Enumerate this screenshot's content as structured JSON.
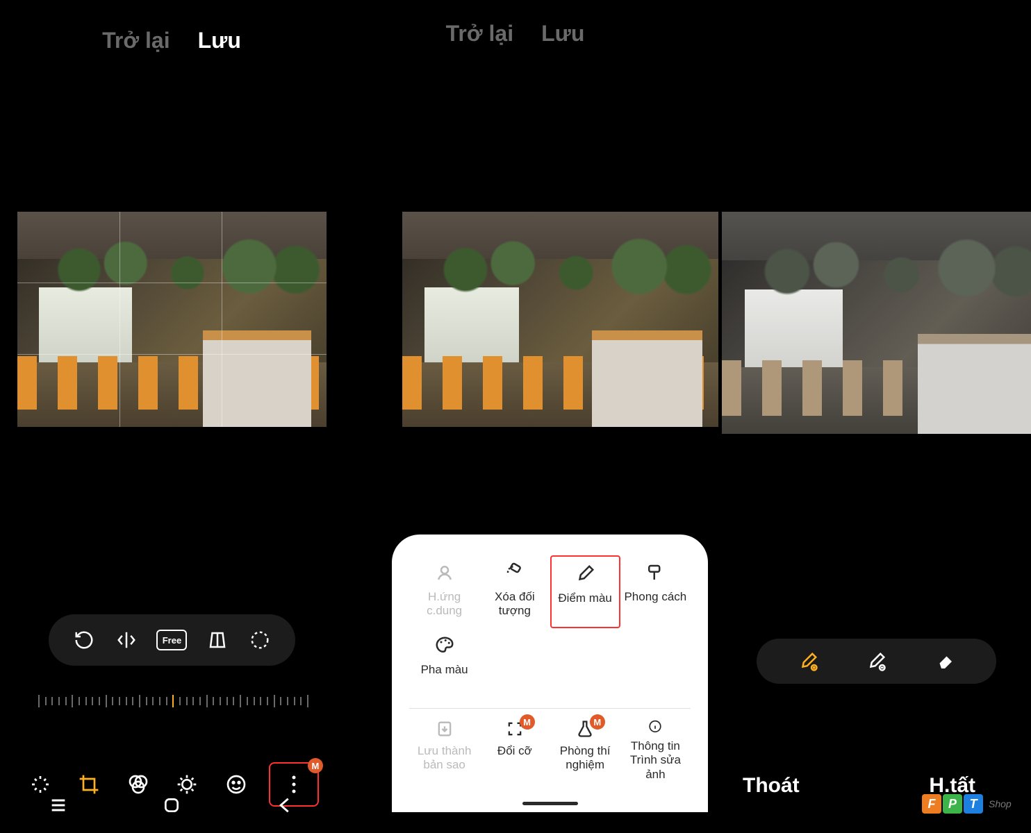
{
  "panel1": {
    "header": {
      "back": "Trở lại",
      "save": "Lưu"
    },
    "pill_icons": [
      "rotate",
      "flip-horizontal",
      "free-ratio",
      "perspective",
      "circle-crop"
    ],
    "free_label": "Free",
    "bottom_icons": [
      "auto",
      "crop",
      "filters",
      "adjust",
      "emoji",
      "more"
    ],
    "more_badge": "M",
    "nav": [
      "recents",
      "home",
      "back"
    ]
  },
  "panel2": {
    "header": {
      "back": "Trở lại",
      "save": "Lưu"
    },
    "popup": {
      "row1": [
        {
          "label": "H.ứng c.dung",
          "icon": "face",
          "dim": true
        },
        {
          "label": "Xóa đối tượng",
          "icon": "erase"
        },
        {
          "label": "Điểm màu",
          "icon": "eyedropper",
          "selected": true
        },
        {
          "label": "Phong cách",
          "icon": "brush-roll"
        }
      ],
      "row1b": [
        {
          "label": "Pha màu",
          "icon": "palette"
        }
      ],
      "row2": [
        {
          "label": "Lưu thành bản sao",
          "icon": "save-copy",
          "dim": true
        },
        {
          "label": "Đổi cỡ",
          "icon": "resize",
          "badge": "M"
        },
        {
          "label": "Phòng thí nghiệm",
          "icon": "lab",
          "badge": "M"
        },
        {
          "label": "Thông tin Trình sửa ảnh",
          "icon": "info"
        }
      ]
    }
  },
  "panel3": {
    "pill_icons": [
      "eyedropper-add",
      "eyedropper-remove",
      "eraser"
    ],
    "bottom": {
      "exit": "Thoát",
      "done": "H.tất"
    }
  },
  "watermark": {
    "letters": [
      "F",
      "P",
      "T"
    ],
    "text": "Shop"
  },
  "colors": {
    "f": "#ee7d22",
    "p": "#3cb44a",
    "t": "#1d7fe0"
  }
}
